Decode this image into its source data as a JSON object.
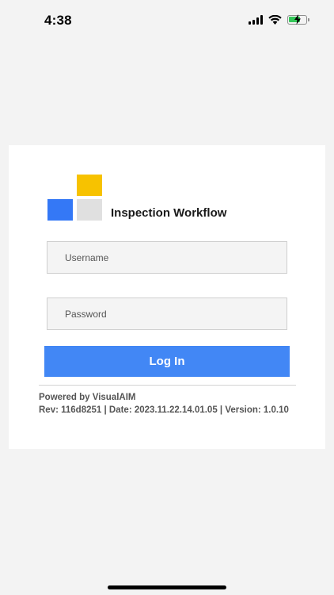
{
  "status_bar": {
    "time": "4:38",
    "icons": [
      "cellular-signal-icon",
      "wifi-icon",
      "battery-charging-icon"
    ]
  },
  "login_card": {
    "app_title": "Inspection Workflow",
    "logo_colors": {
      "yellow": "#f7c200",
      "blue": "#3478f6",
      "grey": "#e0e0e0"
    },
    "username": {
      "placeholder": "Username",
      "value": ""
    },
    "password": {
      "placeholder": "Password",
      "value": ""
    },
    "login_label": "Log In",
    "accent_color": "#4287f5",
    "footer": {
      "powered_by": "Powered by VisualAIM",
      "rev_line": "Rev: 116d8251 | Date: 2023.11.22.14.01.05 | Version: 1.0.10"
    }
  }
}
